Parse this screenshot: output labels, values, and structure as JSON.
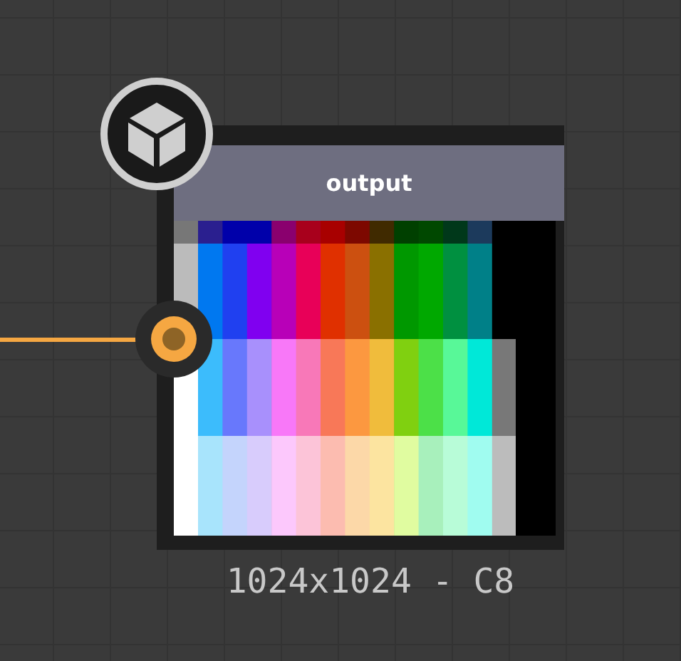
{
  "node": {
    "title": "output",
    "resolution": "1024x1024 - C8",
    "input_connected": true
  }
}
